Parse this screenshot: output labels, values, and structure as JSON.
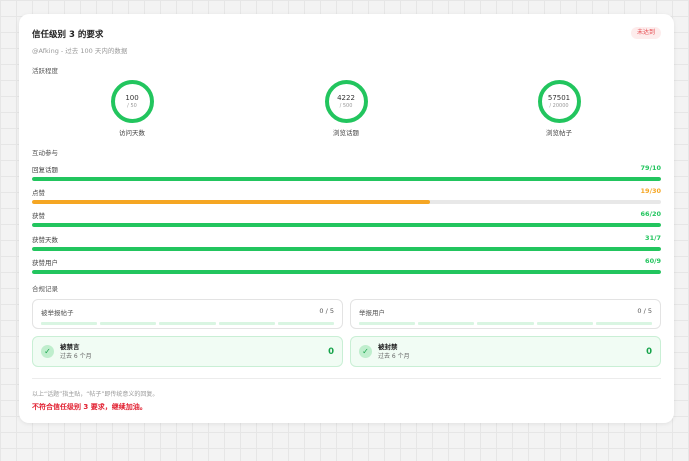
{
  "header": {
    "title": "信任级别 3 的要求",
    "subtitle": "@Afking - 过去 100 天内的数据",
    "status_badge": "未达到"
  },
  "activity": {
    "label": "活跃程度",
    "items": [
      {
        "value": "100",
        "target": "/ 50",
        "label": "访问天数"
      },
      {
        "value": "4222",
        "target": "/ 500",
        "label": "浏览话题"
      },
      {
        "value": "57501",
        "target": "/ 20000",
        "label": "浏览帖子"
      }
    ]
  },
  "interaction": {
    "label": "互动参与",
    "items": [
      {
        "label": "回复话题",
        "value": "79/10",
        "progress": 1.0,
        "color": "#22c55e"
      },
      {
        "label": "点赞",
        "value": "19/30",
        "progress": 0.633,
        "color": "#f5a623"
      },
      {
        "label": "获赞",
        "value": "66/20",
        "progress": 1.0,
        "color": "#22c55e"
      },
      {
        "label": "获赞天数",
        "value": "31/7",
        "progress": 1.0,
        "color": "#22c55e"
      },
      {
        "label": "获赞用户",
        "value": "60/9",
        "progress": 1.0,
        "color": "#22c55e"
      }
    ]
  },
  "compliance": {
    "label": "合规记录",
    "reported_posts": {
      "label": "被举报帖子",
      "count": "0 / 5"
    },
    "reporting_users": {
      "label": "举报用户",
      "count": "0 / 5"
    },
    "silenced": {
      "title": "被禁言",
      "sub": "过去 6 个月",
      "count": "0"
    },
    "suspended": {
      "title": "被封禁",
      "sub": "过去 6 个月",
      "count": "0"
    }
  },
  "footer": {
    "note": "以上“话题”指主贴，“帖子”即传统意义的回复。",
    "result": "不符合信任级别 3 要求，继续加油。"
  },
  "colors": {
    "success": "#22c55e",
    "warning": "#f5a623",
    "danger": "#e11d2e"
  }
}
